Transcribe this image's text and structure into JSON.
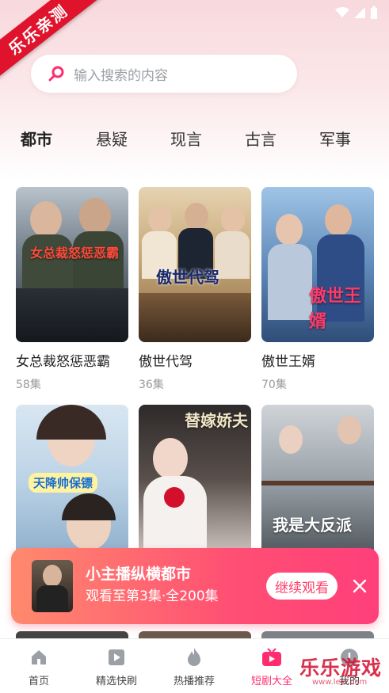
{
  "ribbon": {
    "label": "乐乐亲测"
  },
  "search": {
    "placeholder": "输入搜索的内容"
  },
  "categories": [
    {
      "label": "都市",
      "active": true
    },
    {
      "label": "悬疑"
    },
    {
      "label": "现言"
    },
    {
      "label": "古言"
    },
    {
      "label": "军事"
    }
  ],
  "dramas": [
    {
      "title": "女总裁怒惩恶霸",
      "episodes": "58集",
      "poster_text": "女总裁怒惩恶霸"
    },
    {
      "title": "傲世代驾",
      "episodes": "36集",
      "poster_text": "傲世代驾"
    },
    {
      "title": "傲世王婿",
      "episodes": "70集",
      "poster_text": "傲世王婿"
    },
    {
      "poster_text": "天降帅保镖"
    },
    {
      "poster_text": "替嫁娇夫"
    },
    {
      "poster_text": "我是大反派"
    }
  ],
  "banner": {
    "title": "小主播纵横都市",
    "subtitle": "观看至第3集·全200集",
    "button": "继续观看"
  },
  "tabs": [
    {
      "label": "首页",
      "icon": "home-icon"
    },
    {
      "label": "精选快刷",
      "icon": "play-icon"
    },
    {
      "label": "热播推荐",
      "icon": "flame-icon"
    },
    {
      "label": "短剧大全",
      "icon": "tv-icon",
      "active": true
    },
    {
      "label": "我的",
      "icon": "profile-icon"
    }
  ],
  "watermark": {
    "text": "乐乐游戏",
    "sub": "www.lele.com"
  },
  "colors": {
    "accent": "#ff2d6f",
    "ribbon": "#e0132d",
    "banner_start": "#ff8a6e",
    "banner_end": "#ff3f7a"
  }
}
